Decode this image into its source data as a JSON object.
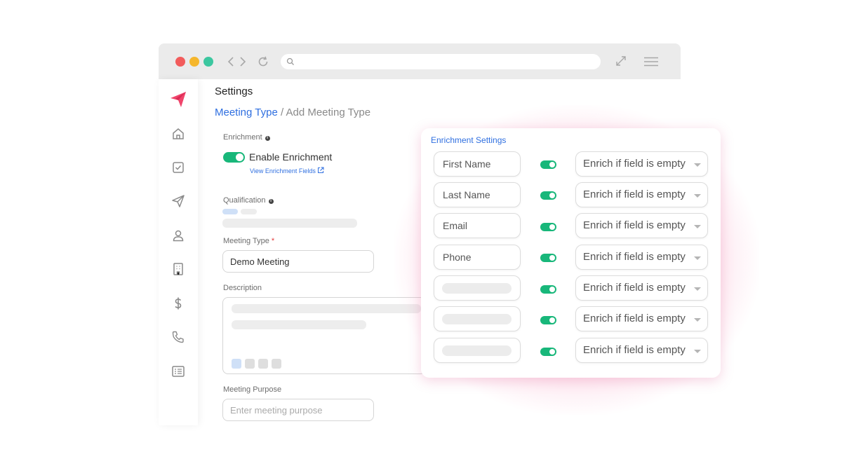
{
  "colors": {
    "accent_blue": "#2f6fe0",
    "toggle_green": "#18b77a",
    "brand_pink": "#f0446b",
    "traffic_red": "#f25c5c",
    "traffic_yellow": "#f5b62c",
    "traffic_green": "#3cc7a0"
  },
  "browser": {
    "icons": [
      "back-icon",
      "forward-icon",
      "reload-icon",
      "search-icon",
      "expand-icon",
      "menu-icon"
    ]
  },
  "sidebar": {
    "items": [
      {
        "icon": "paper-plane-logo-icon"
      },
      {
        "icon": "home-icon"
      },
      {
        "icon": "checkbox-icon"
      },
      {
        "icon": "send-icon"
      },
      {
        "icon": "user-icon"
      },
      {
        "icon": "building-icon"
      },
      {
        "icon": "dollar-icon"
      },
      {
        "icon": "phone-icon"
      },
      {
        "icon": "list-icon"
      }
    ]
  },
  "main": {
    "title": "Settings",
    "breadcrumb": {
      "link": "Meeting Type",
      "separator": " / ",
      "current": "Add Meeting Type"
    },
    "enrichment": {
      "label": "Enrichment",
      "toggle_label": "Enable Enrichment",
      "toggle_on": true,
      "link_text": "View Enrichment Fields"
    },
    "qualification": {
      "label": "Qualification"
    },
    "meeting_type": {
      "label": "Meeting Type",
      "required_mark": "*",
      "value": "Demo Meeting"
    },
    "description": {
      "label": "Description"
    },
    "meeting_purpose": {
      "label": "Meeting Purpose",
      "placeholder": "Enter meeting purpose"
    }
  },
  "enrichment_panel": {
    "title": "Enrichment Settings",
    "rows": [
      {
        "field": "First Name",
        "enabled": true,
        "rule": "Enrich if field is empty"
      },
      {
        "field": "Last Name",
        "enabled": true,
        "rule": "Enrich if field is empty"
      },
      {
        "field": "Email",
        "enabled": true,
        "rule": "Enrich if field is empty"
      },
      {
        "field": "Phone",
        "enabled": true,
        "rule": "Enrich if field is empty"
      },
      {
        "field": "",
        "enabled": true,
        "rule": "Enrich if field is empty"
      },
      {
        "field": "",
        "enabled": true,
        "rule": "Enrich if field is empty"
      },
      {
        "field": "",
        "enabled": true,
        "rule": "Enrich if field is empty"
      }
    ]
  }
}
